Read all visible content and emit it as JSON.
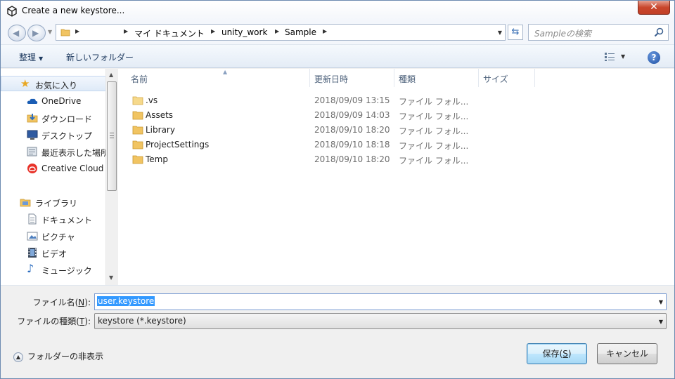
{
  "window": {
    "title": "Create a new keystore...",
    "close_label": "✕"
  },
  "address": {
    "crumbs": [
      "マイ ドキュメント",
      "unity_work",
      "Sample"
    ]
  },
  "search": {
    "placeholder": "Sampleの検索"
  },
  "toolbar": {
    "organize_label": "整理",
    "new_folder_label": "新しいフォルダー",
    "help_label": "?"
  },
  "nav": {
    "favorites_label": "お気に入り",
    "favorites": [
      "OneDrive",
      "ダウンロード",
      "デスクトップ",
      "最近表示した場所",
      "Creative Cloud"
    ],
    "library_label": "ライブラリ",
    "libraries": [
      "ドキュメント",
      "ピクチャ",
      "ビデオ",
      "ミュージック"
    ]
  },
  "columns": {
    "name": "名前",
    "date": "更新日時",
    "type": "種類",
    "size": "サイズ"
  },
  "files": [
    {
      "name": ".vs",
      "date": "2018/09/09 13:15",
      "type": "ファイル フォル..."
    },
    {
      "name": "Assets",
      "date": "2018/09/09 14:03",
      "type": "ファイル フォル..."
    },
    {
      "name": "Library",
      "date": "2018/09/10 18:20",
      "type": "ファイル フォル..."
    },
    {
      "name": "ProjectSettings",
      "date": "2018/09/10 18:18",
      "type": "ファイル フォル..."
    },
    {
      "name": "Temp",
      "date": "2018/09/10 18:20",
      "type": "ファイル フォル..."
    }
  ],
  "form": {
    "filename_label": "ファイル名(",
    "filename_key": "N",
    "filename_label_end": "):",
    "filename_value": "user.keystore",
    "filetype_label": "ファイルの種類(",
    "filetype_key": "T",
    "filetype_label_end": "):",
    "filetype_value": "keystore (*.keystore)",
    "hide_folders_label": "フォルダーの非表示",
    "save_label": "保存(",
    "save_key": "S",
    "save_label_end": ")",
    "cancel_label": "キャンセル"
  },
  "colors": {
    "selection": "#3399ff",
    "folder": "#f1c462"
  }
}
